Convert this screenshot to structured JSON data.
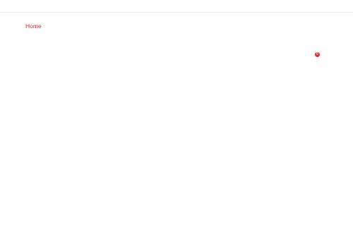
{
  "header": {
    "breadcrumb": {
      "home_label": "Home"
    }
  },
  "cart": {
    "count": "0"
  },
  "colors": {
    "accent": "#e4262b",
    "divider": "#ececec",
    "background": "#ffffff"
  }
}
